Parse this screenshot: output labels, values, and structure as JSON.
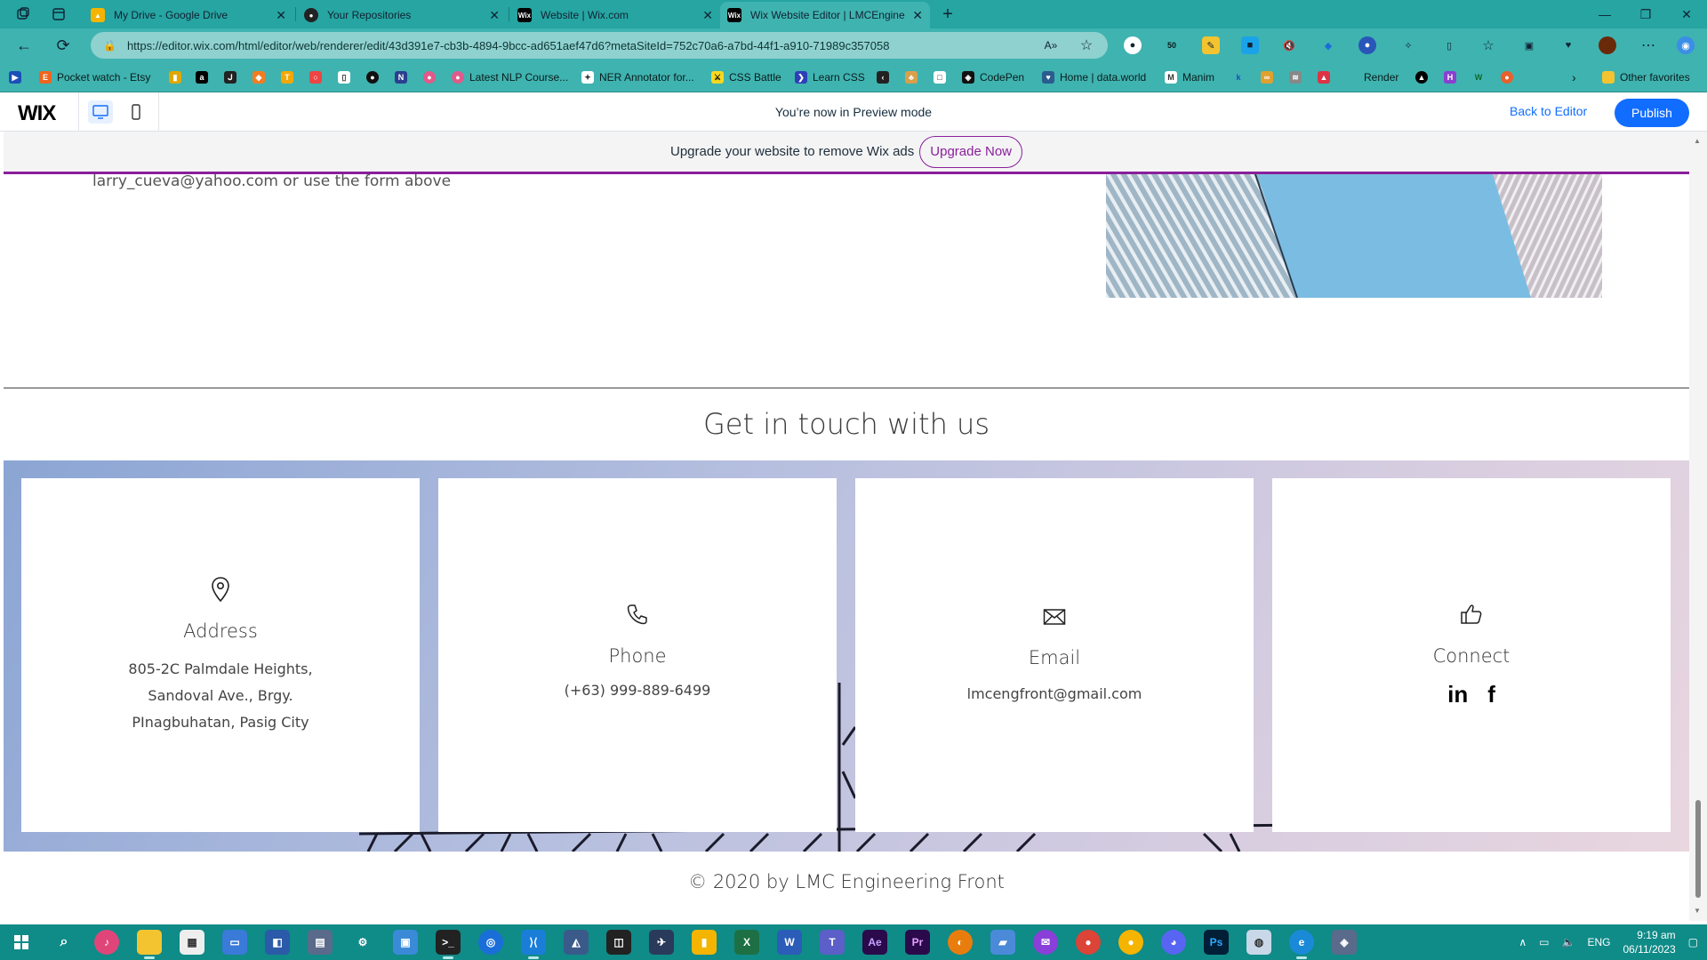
{
  "browser": {
    "tabs": [
      {
        "title": "My Drive - Google Drive",
        "icon": "google-drive-icon",
        "color": "#f4b400"
      },
      {
        "title": "Your Repositories",
        "icon": "github-icon",
        "color": "#222222"
      },
      {
        "title": "Website | Wix.com",
        "icon": "wix-icon",
        "color": "#000000"
      },
      {
        "title": "Wix Website Editor | LMCEngine",
        "icon": "wix-icon",
        "color": "#000000"
      }
    ],
    "url": "https://editor.wix.com/html/editor/web/renderer/edit/43d391e7-cb3b-4894-9bcc-ad651aef47d6?metaSiteId=752c70a6-a7bd-44f1-a910-71989c357058",
    "extension_badge": "50",
    "favorites": [
      {
        "label": "Pocket watch - Etsy",
        "icon": "etsy-icon"
      },
      {
        "label": "Latest NLP Course...",
        "icon": "nlp-icon"
      },
      {
        "label": "NER Annotator for...",
        "icon": "ner-icon"
      },
      {
        "label": "CSS Battle",
        "icon": "css-battle-icon"
      },
      {
        "label": "Learn CSS",
        "icon": "learn-css-icon"
      },
      {
        "label": "CodePen",
        "icon": "codepen-icon"
      },
      {
        "label": "Home | data.world",
        "icon": "data-world-icon"
      },
      {
        "label": "Manim",
        "icon": "manim-icon"
      },
      {
        "label": "Render",
        "icon": "render-icon"
      },
      {
        "label": "Other favorites",
        "icon": "folder-icon"
      }
    ]
  },
  "wix_bar": {
    "logo": "WIX",
    "preview_text": "You’re now in Preview mode",
    "back_to_editor": "Back to Editor",
    "publish": "Publish"
  },
  "site": {
    "upgrade_text": "Upgrade your website to remove Wix ads",
    "upgrade_button": "Upgrade Now",
    "contact_line": "larry_cueva@yahoo.com or use the form above",
    "get_in_touch_title": "Get in touch with us",
    "cards": [
      {
        "title": "Address",
        "icon": "location-pin-icon",
        "lines": [
          "805-2C Palmdale Heights,",
          "Sandoval Ave., Brgy.",
          "PInagbuhatan, Pasig City"
        ]
      },
      {
        "title": "Phone",
        "icon": "phone-icon",
        "lines": [
          "(+63) 999-889-6499"
        ]
      },
      {
        "title": "Email",
        "icon": "envelope-icon",
        "lines": [
          "lmcengfront@gmail.com"
        ]
      },
      {
        "title": "Connect",
        "icon": "thumbs-up-icon",
        "social": [
          "in",
          "f"
        ]
      }
    ],
    "footer": "© 2020 by LMC Engineering Front"
  },
  "taskbar": {
    "lang": "ENG",
    "time": "9:19 am",
    "date": "06/11/2023"
  },
  "colors": {
    "browser_teal": "#3fb3b0",
    "tab_strip": "#26a5a2",
    "wix_blue": "#116dff",
    "upgrade_purple": "#8a1f9b",
    "taskbar": "#0f8b88"
  }
}
